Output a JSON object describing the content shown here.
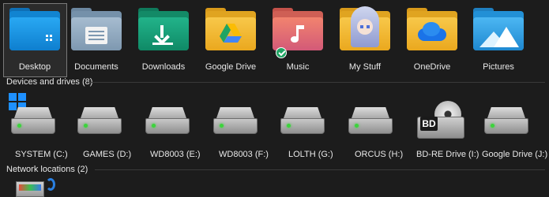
{
  "folders": [
    {
      "label": "Desktop",
      "icon": "desktop-folder-icon",
      "color": "#1e9be8"
    },
    {
      "label": "Documents",
      "icon": "documents-folder-icon",
      "color": "#8aa6c0"
    },
    {
      "label": "Downloads",
      "icon": "downloads-folder-icon",
      "color": "#1aa07a"
    },
    {
      "label": "Google Drive",
      "icon": "google-drive-folder-icon",
      "color": "#f2b42a"
    },
    {
      "label": "Music",
      "icon": "music-folder-icon",
      "color": "#e77a5c"
    },
    {
      "label": "My Stuff",
      "icon": "anime-folder-icon",
      "color": "#f2b42a"
    },
    {
      "label": "OneDrive",
      "icon": "onedrive-folder-icon",
      "color": "#f2b42a"
    },
    {
      "label": "Pictures",
      "icon": "pictures-folder-icon",
      "color": "#2aa2e6"
    }
  ],
  "devices_section": {
    "title": "Devices and drives (8)"
  },
  "drives": [
    {
      "label": "SYSTEM (C:)"
    },
    {
      "label": "GAMES (D:)"
    },
    {
      "label": "WD8003 (E:)"
    },
    {
      "label": "WD8003 (F:)"
    },
    {
      "label": "LOLTH (G:)"
    },
    {
      "label": "ORCUS (H:)"
    },
    {
      "label": "BD-RE Drive (I:)",
      "badge": "BD"
    },
    {
      "label": "Google Drive (J:)"
    }
  ],
  "network_section": {
    "title": "Network locations (2)"
  }
}
